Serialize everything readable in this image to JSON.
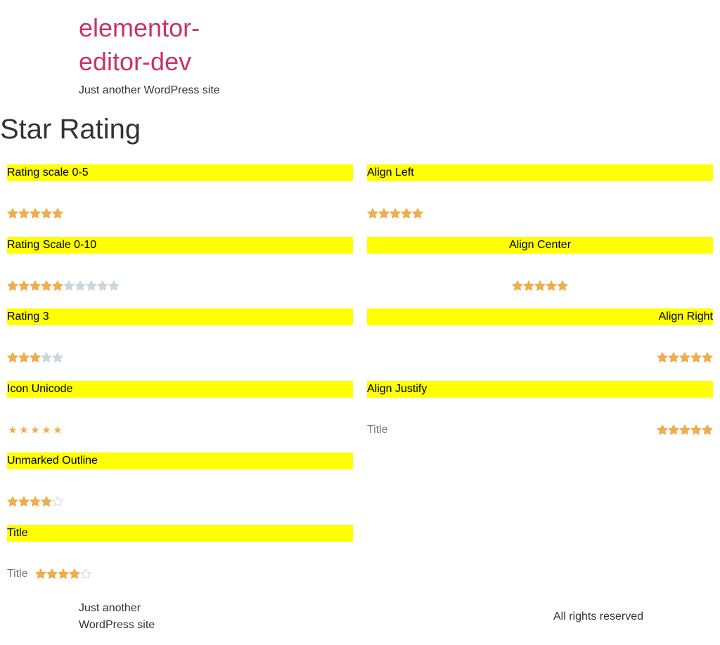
{
  "site": {
    "title": "elementor-editor-dev",
    "tagline": "Just another WordPress site"
  },
  "page": {
    "title": "Star Rating"
  },
  "colors": {
    "star_filled": "#f0ad4e",
    "star_empty": "#ccd6df",
    "heading_bg": "#ffff00",
    "site_title": "#c8336a"
  },
  "left_widgets": [
    {
      "heading": "Rating scale 0-5",
      "rating": 5,
      "scale": 5,
      "style": "solid"
    },
    {
      "heading": "Rating Scale 0-10",
      "rating": 5,
      "scale": 10,
      "style": "solid"
    },
    {
      "heading": "Rating 3",
      "rating": 3,
      "scale": 5,
      "style": "solid"
    },
    {
      "heading": "Icon Unicode",
      "rating": 5,
      "scale": 5,
      "style": "unicode"
    },
    {
      "heading": "Unmarked Outline",
      "rating": 4,
      "scale": 5,
      "style": "outline"
    },
    {
      "heading": "Title",
      "rating": 4,
      "scale": 5,
      "style": "outline",
      "title": "Title"
    }
  ],
  "right_widgets": [
    {
      "heading": "Align Left",
      "rating": 5,
      "scale": 5,
      "style": "solid",
      "align": "left"
    },
    {
      "heading": "Align Center",
      "rating": 5,
      "scale": 5,
      "style": "solid",
      "align": "center"
    },
    {
      "heading": "Align Right",
      "rating": 5,
      "scale": 5,
      "style": "solid",
      "align": "right"
    },
    {
      "heading": "Align Justify",
      "rating": 5,
      "scale": 5,
      "style": "solid",
      "align": "justify",
      "title": "Title"
    }
  ],
  "footer": {
    "tagline": "Just another WordPress site",
    "copyright": "All rights reserved"
  }
}
